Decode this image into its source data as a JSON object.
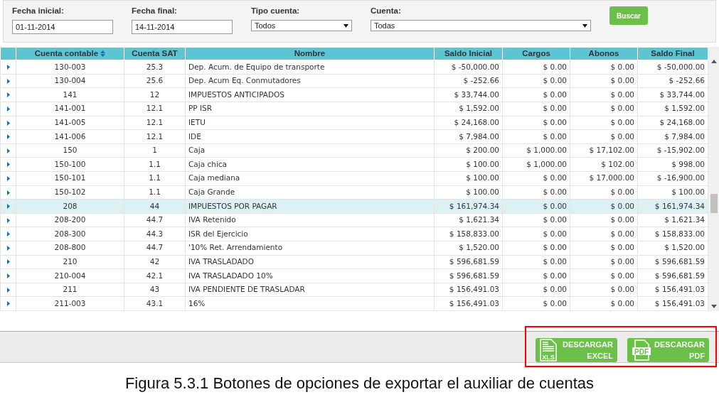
{
  "filters": [
    {
      "kind": "text",
      "label": "Fecha inicial:",
      "value": "01-11-2014"
    },
    {
      "kind": "text",
      "label": "Fecha final:",
      "value": "14-11-2014"
    },
    {
      "kind": "select",
      "label": "Tipo cuenta:",
      "value": "Todos"
    },
    {
      "kind": "select",
      "label": "Cuenta:",
      "value": "Todas"
    }
  ],
  "search_button": "Buscar",
  "table": {
    "columns": [
      {
        "label": "Cuenta contable",
        "sorted": true
      },
      {
        "label": "Cuenta SAT",
        "sorted": false
      },
      {
        "label": "Nombre",
        "sorted": false
      },
      {
        "label": "Saldo Inicial",
        "sorted": false
      },
      {
        "label": "Cargos",
        "sorted": false
      },
      {
        "label": "Abonos",
        "sorted": false
      },
      {
        "label": "Saldo Final",
        "sorted": false
      }
    ],
    "rows": [
      {
        "selected": false,
        "cells": [
          "130-003",
          "25.3",
          "Dep. Acum. de Equipo de transporte",
          "$ -50,000.00",
          "$ 0.00",
          "$ 0.00",
          "$ -50,000.00"
        ]
      },
      {
        "selected": false,
        "cells": [
          "130-004",
          "25.6",
          "Dep. Acum Eq. Conmutadores",
          "$ -252.66",
          "$ 0.00",
          "$ 0.00",
          "$ -252.66"
        ]
      },
      {
        "selected": false,
        "cells": [
          "141",
          "12",
          "IMPUESTOS ANTICIPADOS",
          "$ 33,744.00",
          "$ 0.00",
          "$ 0.00",
          "$ 33,744.00"
        ]
      },
      {
        "selected": false,
        "cells": [
          "141-001",
          "12.1",
          "PP ISR",
          "$ 1,592.00",
          "$ 0.00",
          "$ 0.00",
          "$ 1,592.00"
        ]
      },
      {
        "selected": false,
        "cells": [
          "141-005",
          "12.1",
          "IETU",
          "$ 24,168.00",
          "$ 0.00",
          "$ 0.00",
          "$ 24,168.00"
        ]
      },
      {
        "selected": false,
        "cells": [
          "141-006",
          "12.1",
          "IDE",
          "$ 7,984.00",
          "$ 0.00",
          "$ 0.00",
          "$ 7,984.00"
        ]
      },
      {
        "selected": false,
        "cells": [
          "150",
          "1",
          "Caja",
          "$ 200.00",
          "$ 1,000.00",
          "$ 17,102.00",
          "$ -15,902.00"
        ]
      },
      {
        "selected": false,
        "cells": [
          "150-100",
          "1.1",
          "Caja chica",
          "$ 100.00",
          "$ 1,000.00",
          "$ 102.00",
          "$ 998.00"
        ]
      },
      {
        "selected": false,
        "cells": [
          "150-101",
          "1.1",
          "Caja mediana",
          "$ 100.00",
          "$ 0.00",
          "$ 17,000.00",
          "$ -16,900.00"
        ]
      },
      {
        "selected": false,
        "cells": [
          "150-102",
          "1.1",
          "Caja Grande",
          "$ 100.00",
          "$ 0.00",
          "$ 0.00",
          "$ 100.00"
        ]
      },
      {
        "selected": true,
        "cells": [
          "208",
          "44",
          "IMPUESTOS POR PAGAR",
          "$ 161,974.34",
          "$ 0.00",
          "$ 0.00",
          "$ 161,974.34"
        ]
      },
      {
        "selected": false,
        "cells": [
          "208-200",
          "44.7",
          "IVA Retenido",
          "$ 1,621.34",
          "$ 0.00",
          "$ 0.00",
          "$ 1,621.34"
        ]
      },
      {
        "selected": false,
        "cells": [
          "208-300",
          "44.3",
          "ISR del Ejercicio",
          "$ 158,833.00",
          "$ 0.00",
          "$ 0.00",
          "$ 158,833.00"
        ]
      },
      {
        "selected": false,
        "cells": [
          "208-800",
          "44.7",
          "'10% Ret. Arrendamiento",
          "$ 1,520.00",
          "$ 0.00",
          "$ 0.00",
          "$ 1,520.00"
        ]
      },
      {
        "selected": false,
        "cells": [
          "210",
          "42",
          "IVA TRASLADADO",
          "$ 596,681.59",
          "$ 0.00",
          "$ 0.00",
          "$ 596,681.59"
        ]
      },
      {
        "selected": false,
        "cells": [
          "210-004",
          "42.1",
          "IVA TRASLADADO 10%",
          "$ 596,681.59",
          "$ 0.00",
          "$ 0.00",
          "$ 596,681.59"
        ]
      },
      {
        "selected": false,
        "cells": [
          "211",
          "43",
          "IVA PENDIENTE DE TRASLADAR",
          "$ 156,491.03",
          "$ 0.00",
          "$ 0.00",
          "$ 156,491.03"
        ]
      },
      {
        "selected": false,
        "cells": [
          "211-003",
          "43.1",
          "16%",
          "$ 156,491.03",
          "$ 0.00",
          "$ 0.00",
          "$ 156,491.03"
        ]
      }
    ]
  },
  "export_buttons": [
    {
      "kind": "excel",
      "icon_text": "XLS",
      "label_lines": [
        "DESCARGAR",
        "EXCEL"
      ]
    },
    {
      "kind": "pdf",
      "icon_text": "PDF",
      "label_lines": [
        "DESCARGAR",
        "PDF"
      ]
    }
  ],
  "highlighted": true,
  "caption": "Figura 5.3.1 Botones de opciones de exportar el auxiliar de cuentas"
}
